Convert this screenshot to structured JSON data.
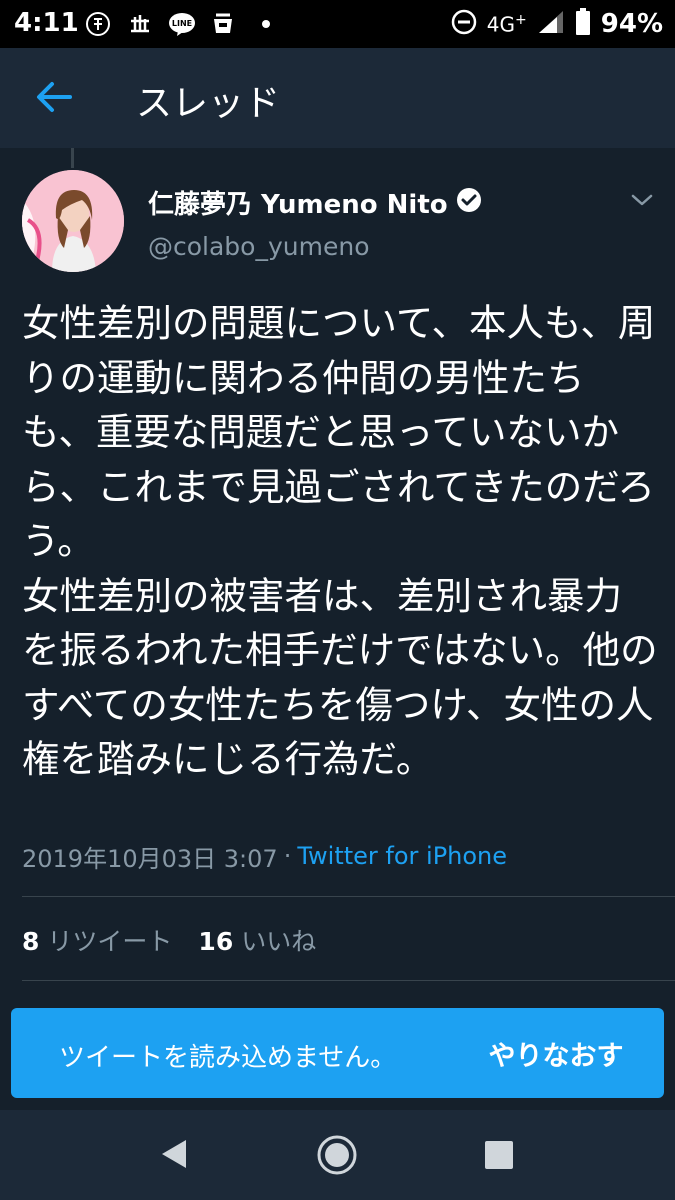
{
  "status_bar": {
    "time": "4:11",
    "network": "4G",
    "battery": "94%",
    "icons": [
      "notification-app-icon",
      "notification-app-icon-2",
      "line-app-icon",
      "notification-cup-icon",
      "dot-icon"
    ],
    "line_icon_text": "LINE"
  },
  "header": {
    "title": "スレッド",
    "back_icon": "arrow-left-icon"
  },
  "tweet": {
    "display_name": "仁藤夢乃 Yumeno Nito",
    "verified": true,
    "handle": "@colabo_yumeno",
    "text": "女性差別の問題について、本人も、周りの運動に関わる仲間の男性たちも、重要な問題だと思っていないから、これまで見過ごされてきたのだろう。\n女性差別の被害者は、差別され暴力を振るわれた相手だけではない。他のすべての女性たちを傷つけ、女性の人権を踏みにじる行為だ。",
    "date": "2019年10月03日 3:07",
    "separator": "·",
    "source": "Twitter for iPhone",
    "retweets_count": "8",
    "retweets_label": "リツイート",
    "likes_count": "16",
    "likes_label": "いいね"
  },
  "error_banner": {
    "message": "ツイートを読み込めません。",
    "retry_label": "やりなおす"
  },
  "nav_bar": {
    "icons": [
      "nav-back-icon",
      "nav-home-icon",
      "nav-recents-icon"
    ]
  },
  "colors": {
    "background": "#15202b",
    "header": "#1c2938",
    "accent": "#1da1f2",
    "secondary_text": "#8899a6"
  }
}
